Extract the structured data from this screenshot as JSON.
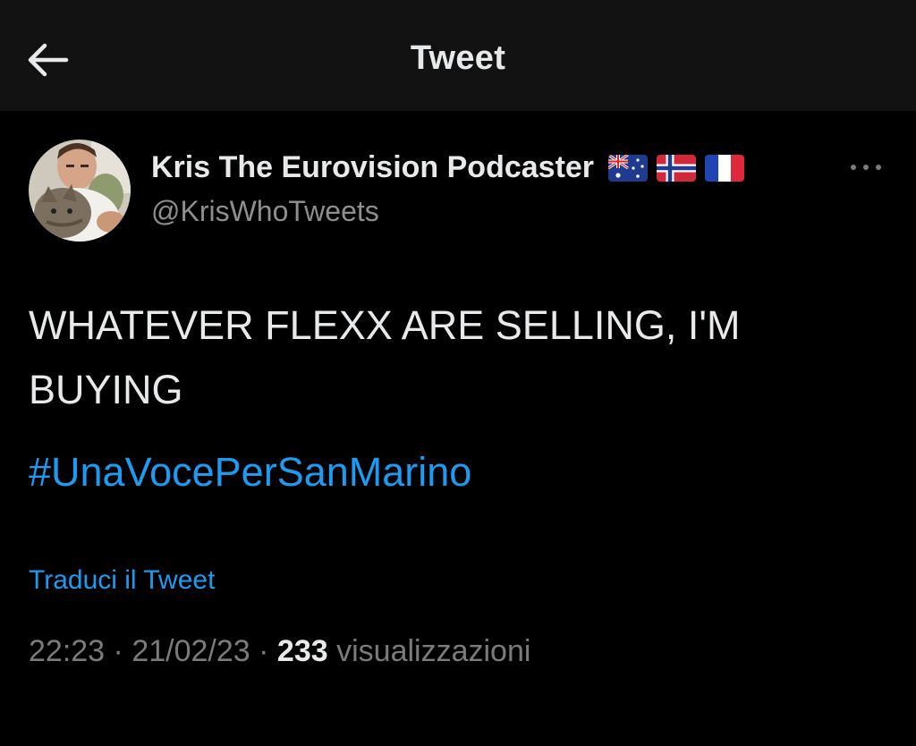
{
  "header": {
    "title": "Tweet",
    "back_icon": "arrow-left-icon"
  },
  "author": {
    "display_name": "Kris The Eurovision Podcaster",
    "handle": "@KrisWhoTweets",
    "flags": [
      "flag-australia-icon",
      "flag-norway-icon",
      "flag-france-icon"
    ],
    "more_icon": "more-horizontal-icon"
  },
  "tweet": {
    "text": "WHATEVER FLEXX ARE SELLING, I'M BUYING",
    "hashtag": "#UnaVocePerSanMarino",
    "translate_label": "Traduci il Tweet",
    "time": "22:23",
    "date": "21/02/23",
    "separator": "·",
    "views_count": "233",
    "views_label": "visualizzazioni"
  },
  "colors": {
    "background": "#000000",
    "header_background": "#121212",
    "accent": "#1d9bf0",
    "muted": "#7b7b7b"
  }
}
